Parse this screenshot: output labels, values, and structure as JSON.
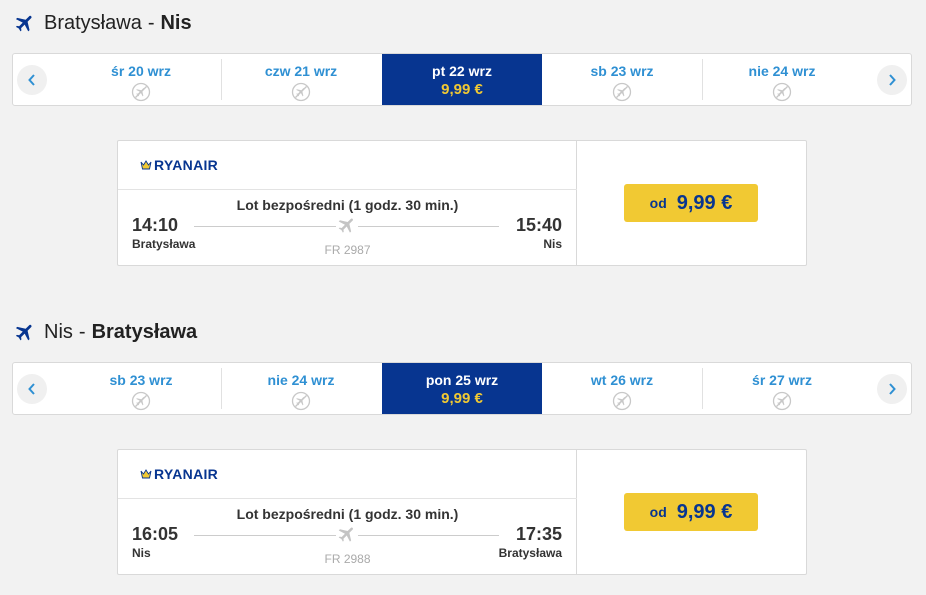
{
  "colors": {
    "brand_blue": "#073590",
    "accent_yellow": "#f1c933",
    "link_blue": "#2f90d3",
    "background": "#f2f2f2"
  },
  "outbound": {
    "origin": "Bratysława",
    "separator": "-",
    "destination": "Nis",
    "icon": "plane-icon",
    "days": [
      {
        "label": "śr 20 wrz",
        "price": "",
        "selected": false
      },
      {
        "label": "czw 21 wrz",
        "price": "",
        "selected": false
      },
      {
        "label": "pt 22 wrz",
        "price": "9,99 €",
        "selected": true
      },
      {
        "label": "sb 23 wrz",
        "price": "",
        "selected": false
      },
      {
        "label": "nie 24 wrz",
        "price": "",
        "selected": false
      }
    ],
    "flight": {
      "airline": "RYANAIR",
      "type": "Lot bezpośredni (1 godz. 30 min.)",
      "dep_time": "14:10",
      "dep_city": "Bratysława",
      "arr_time": "15:40",
      "arr_city": "Nis",
      "number": "FR 2987",
      "price_prefix": "od",
      "price": "9,99 €"
    }
  },
  "return": {
    "origin": "Nis",
    "separator": "-",
    "destination": "Bratysława",
    "icon": "plane-icon",
    "days": [
      {
        "label": "sb 23 wrz",
        "price": "",
        "selected": false
      },
      {
        "label": "nie 24 wrz",
        "price": "",
        "selected": false
      },
      {
        "label": "pon 25 wrz",
        "price": "9,99 €",
        "selected": true
      },
      {
        "label": "wt 26 wrz",
        "price": "",
        "selected": false
      },
      {
        "label": "śr 27 wrz",
        "price": "",
        "selected": false
      }
    ],
    "flight": {
      "airline": "RYANAIR",
      "type": "Lot bezpośredni (1 godz. 30 min.)",
      "dep_time": "16:05",
      "dep_city": "Nis",
      "arr_time": "17:35",
      "arr_city": "Bratysława",
      "number": "FR 2988",
      "price_prefix": "od",
      "price": "9,99 €"
    }
  }
}
